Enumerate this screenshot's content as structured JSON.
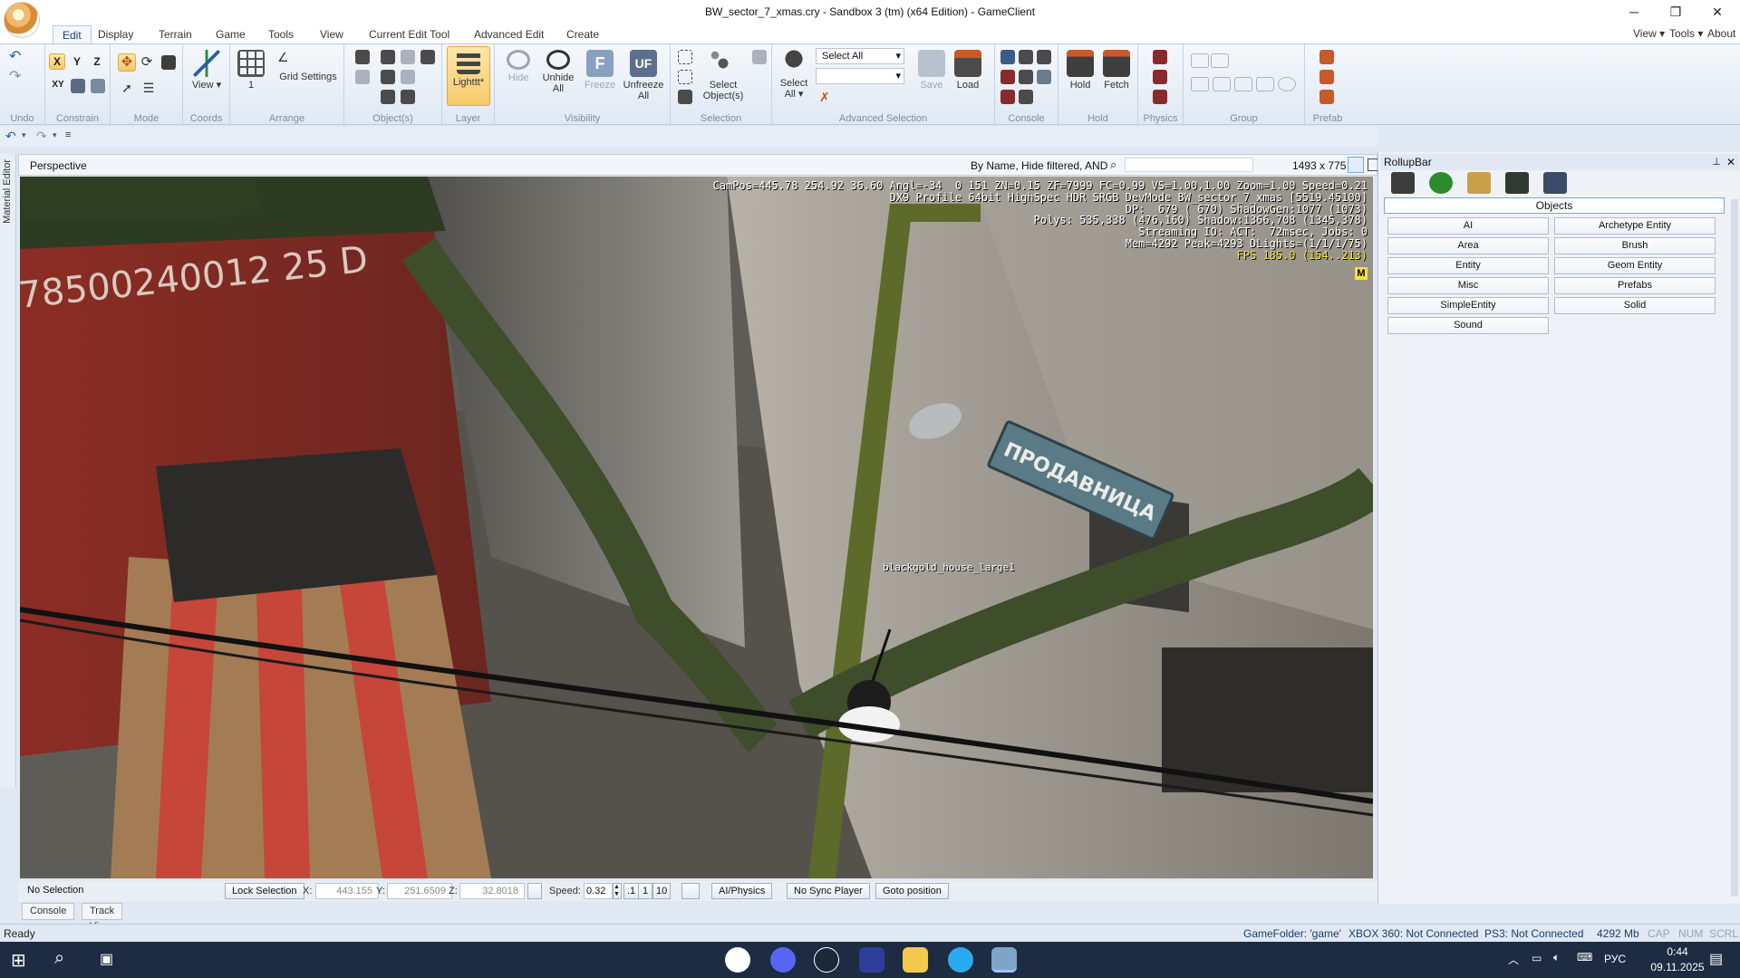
{
  "window": {
    "title": "BW_sector_7_xmas.cry - Sandbox 3 (tm) (x64 Edition) - GameClient",
    "minimize": "─",
    "maximize": "❐",
    "close": "✕"
  },
  "tabs": [
    "Edit",
    "Display",
    "Terrain",
    "Game",
    "Tools",
    "View",
    "Current Edit Tool",
    "Advanced Edit",
    "Create"
  ],
  "right_menu": [
    "View",
    "Tools",
    "About"
  ],
  "ribbon": {
    "groups": {
      "undo": "Undo",
      "constrain": "Constrain",
      "mode": "Mode",
      "coords": "Coords",
      "arrange": "Arrange",
      "objects": "Object(s)",
      "layer": "Layer",
      "visibility": "Visibility",
      "selection": "Selection",
      "advanced_selection": "Advanced Selection",
      "console": "Console",
      "hold": "Hold",
      "physics": "Physics",
      "group": "Group",
      "prefab": "Prefab"
    },
    "buttons": {
      "view": "View",
      "coords_value": "1",
      "grid_settings": "Grid Settings",
      "layer": "Lighttt*",
      "hide": "Hide",
      "unhide_all_1": "Unhide",
      "unhide_all_2": "All",
      "freeze": "Freeze",
      "unfreeze_all_1": "Unfreeze",
      "unfreeze_all_2": "All",
      "select_objects_1": "Select",
      "select_objects_2": "Object(s)",
      "select_all_1": "Select",
      "select_all_2": "All",
      "select_all_combo": "Select All",
      "save": "Save",
      "load": "Load",
      "hold": "Hold",
      "fetch": "Fetch"
    },
    "axis": [
      "X",
      "Y",
      "Z",
      "XY"
    ]
  },
  "viewport": {
    "title": "Perspective",
    "filter": "By Name, Hide filtered, AND",
    "resolution": "1493 x 775",
    "hud_lines": [
      "CamPos=445.78 254.92 36.60 Angl=-34  0 151 ZN=0.15 ZF=7999 FC=0.99 VS=1.00,1.00 Zoom=1.00 Speed=0.21",
      "DX9 Profile 64bit HighSpec HDR SRGB DevMode BW_sector_7_xmas [5519.45100]",
      "DP:  679 ( 670) ShadowGen:1077 (1073)",
      "Polys: 535,338 (476,160) Shadow:1366,708 (1345,378)",
      "Streaming IO: ACT:  72msec, Jobs: 0",
      "Mem=4292 Peak=4293 DLights=(1/1/1/75)"
    ],
    "fps": "FPS 185.0 (154..213)",
    "badge": "M",
    "object_label": "blackgold_house_large1",
    "sign_text": "ПРОДАВНИЦА",
    "container_text": "78500240012   25 D"
  },
  "side_strip": "Material Editor",
  "status_strip": {
    "selection": "No Selection",
    "lock_selection": "Lock Selection",
    "x_label": "X:",
    "x_value": "443.155",
    "y_label": "Y:",
    "y_value": "251.6509",
    "z_label": "Z:",
    "z_value": "32.8018",
    "speed_label": "Speed:",
    "speed_value": "0.32",
    "speed_presets": [
      ".1",
      "1",
      "10"
    ],
    "ai_physics": "AI/Physics",
    "no_sync": "No Sync Player",
    "goto": "Goto position"
  },
  "bottom_tabs": [
    "Console",
    "Track View"
  ],
  "statusbar": {
    "ready": "Ready",
    "game_folder": "GameFolder: 'game'",
    "xbox": "XBOX 360: Not Connected",
    "ps3": "PS3: Not Connected",
    "memory": "4292 Mb",
    "cap": "CAP",
    "num": "NUM",
    "scrl": "SCRL"
  },
  "rollup": {
    "title": "RollupBar",
    "header": "Objects",
    "buttons_left": [
      "AI",
      "Area",
      "Entity",
      "Misc",
      "SimpleEntity",
      "Sound"
    ],
    "buttons_right": [
      "Archetype Entity",
      "Brush",
      "Geom Entity",
      "Prefabs",
      "Solid"
    ]
  },
  "taskbar": {
    "lang": "РУС",
    "time": "0:44",
    "date": "09.11.2025"
  },
  "colors": {
    "hud_text": "#ffffff",
    "fps": "#f5e33a",
    "ribbon_bg": "#dfe8f3",
    "taskbar": "#1d2b43"
  }
}
